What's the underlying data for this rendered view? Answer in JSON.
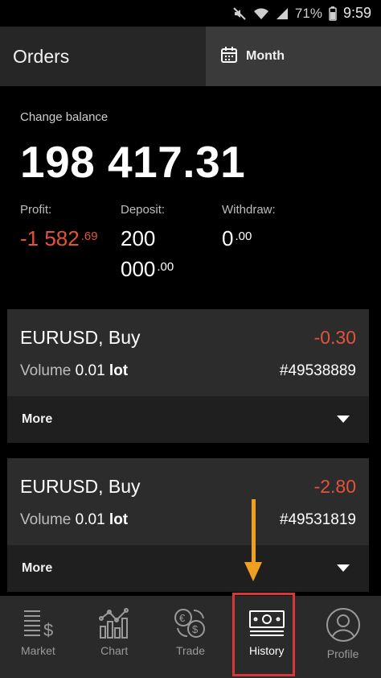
{
  "status_bar": {
    "battery": "71%",
    "time": "9:59",
    "icons": [
      "mute-icon",
      "wifi-icon",
      "signal-icon",
      "battery-icon"
    ]
  },
  "header": {
    "title": "Orders",
    "period_label": "Month",
    "period_icon": "calendar-icon"
  },
  "balance": {
    "label": "Change balance",
    "value": "198 417.31",
    "stats": [
      {
        "label": "Profit:",
        "main": "-1 582",
        "cents": ".69",
        "negative": true
      },
      {
        "label": "Deposit:",
        "main_line1": "200",
        "main_line2": "000",
        "cents": ".00"
      },
      {
        "label": "Withdraw:",
        "main": "0",
        "cents": ".00"
      }
    ]
  },
  "orders": [
    {
      "symbol": "EURUSD,  Buy",
      "profit": "-0.30",
      "volume_label": "Volume",
      "volume": "0.01",
      "lot": "lot",
      "ticket": "#49538889",
      "more_label": "More"
    },
    {
      "symbol": "EURUSD,  Buy",
      "profit": "-2.80",
      "volume_label": "Volume",
      "volume": "0.01",
      "lot": "lot",
      "ticket": "#49531819",
      "more_label": "More"
    }
  ],
  "nav": {
    "items": [
      {
        "label": "Market",
        "icon": "market-icon"
      },
      {
        "label": "Chart",
        "icon": "chart-icon"
      },
      {
        "label": "Trade",
        "icon": "trade-icon"
      },
      {
        "label": "History",
        "icon": "history-icon",
        "active": true
      },
      {
        "label": "Profile",
        "icon": "profile-icon"
      }
    ]
  },
  "colors": {
    "negative": "#e4523b",
    "annotation_arrow": "#f0a020",
    "annotation_box": "#d9363a"
  }
}
